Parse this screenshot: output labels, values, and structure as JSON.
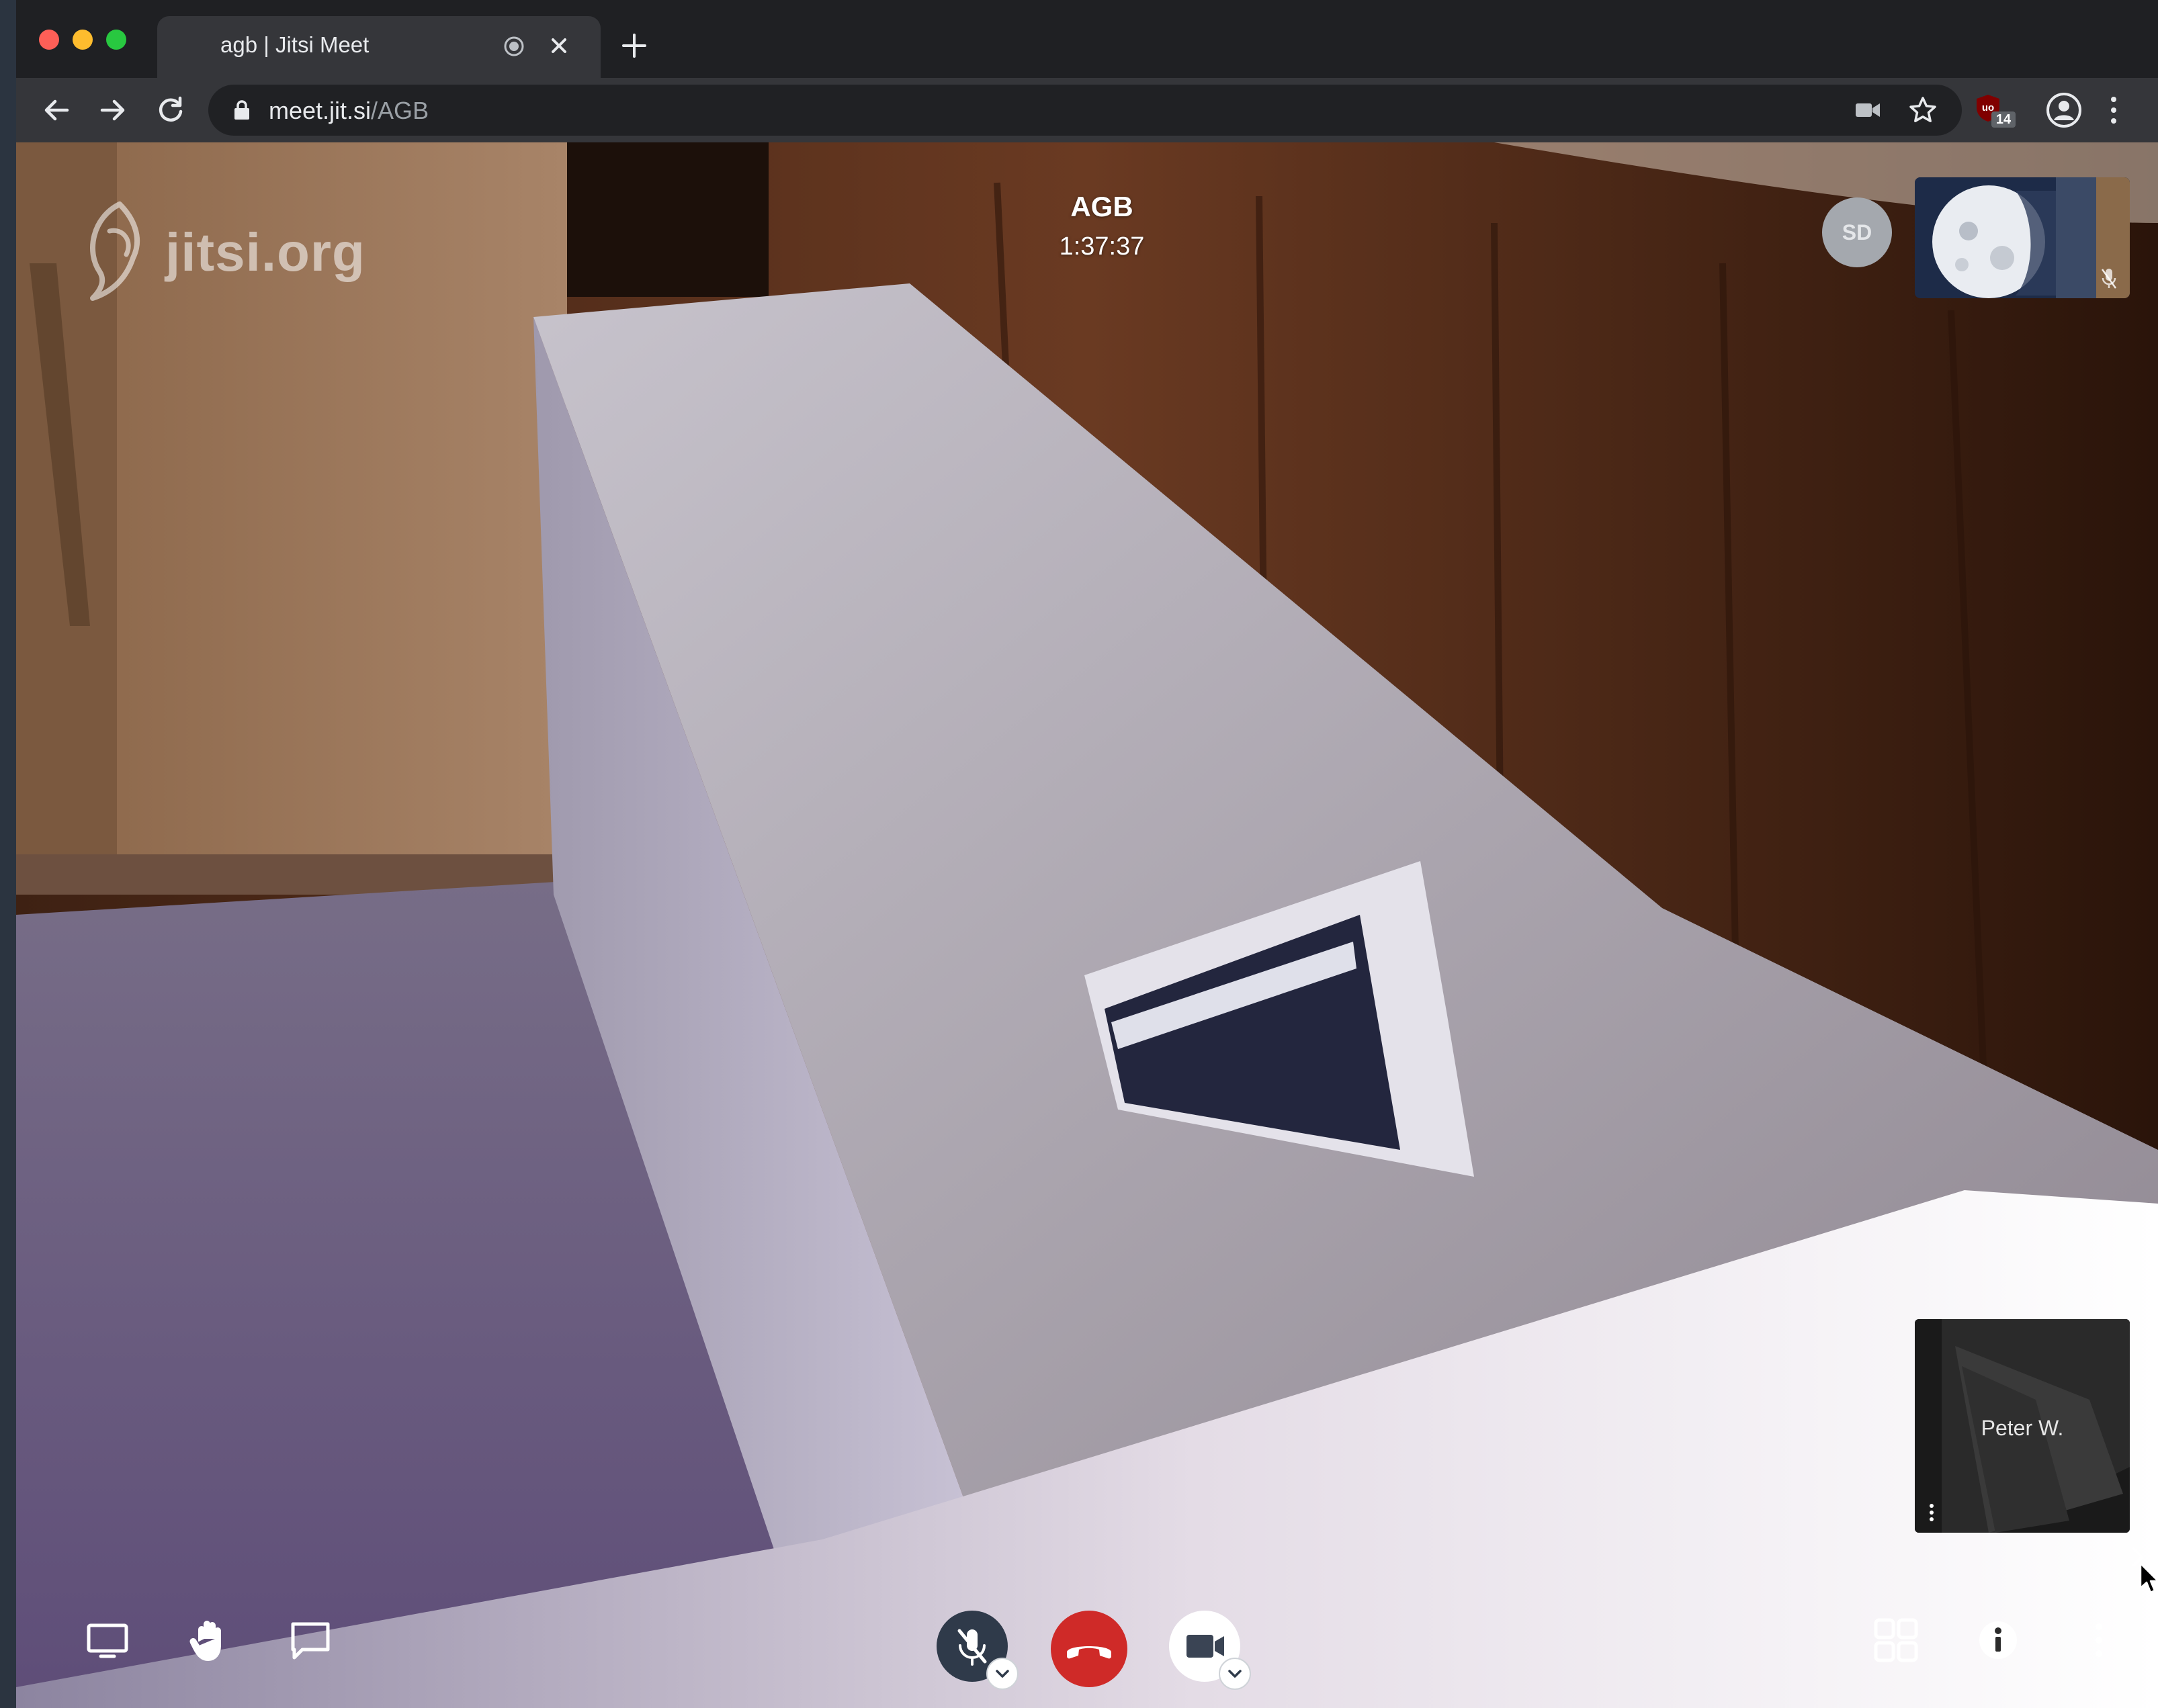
{
  "browser": {
    "tab": {
      "title": "agb | Jitsi Meet"
    },
    "address": {
      "host": "meet.jit.si",
      "path": "/AGB"
    },
    "extension_badge": "14"
  },
  "meeting": {
    "watermark": "jitsi.org",
    "subject": "AGB",
    "timer": "1:37:37",
    "participants": [
      {
        "initials": "SD",
        "kind": "avatar"
      },
      {
        "kind": "video-thumbnail",
        "muted": true
      },
      {
        "name": "Peter W.",
        "kind": "video-thumbnail"
      }
    ]
  },
  "toolbox": {
    "left": [
      "screen-share-icon",
      "raise-hand-icon",
      "chat-icon"
    ],
    "center": [
      "microphone-muted-icon",
      "hangup-icon",
      "camera-icon"
    ],
    "right": [
      "tile-view-icon",
      "info-icon",
      "more-icon"
    ]
  },
  "colors": {
    "hangup": "#cf2a28",
    "mic_button": "#2f3a4a",
    "camera_button": "#ffffff",
    "tab_bg": "#35363a",
    "omnibox_bg": "#202124"
  }
}
